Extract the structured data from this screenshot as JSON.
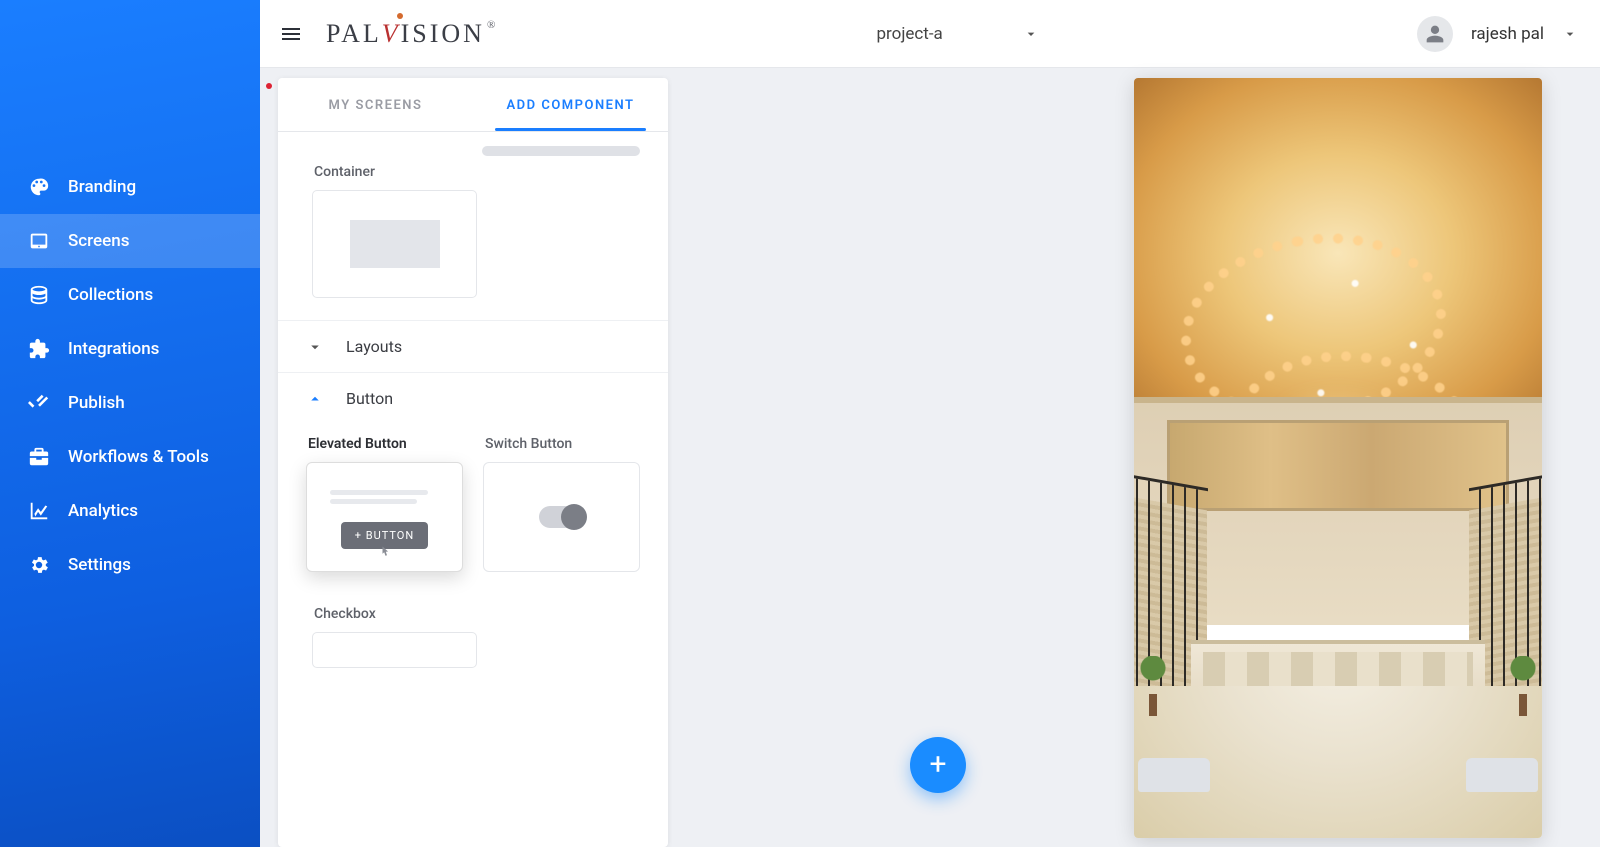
{
  "brand": {
    "name_left": "PAL",
    "name_v": "V",
    "name_right": "ISION",
    "registered": "®"
  },
  "topbar": {
    "project": "project-a",
    "username": "rajesh pal"
  },
  "sidebar": {
    "items": [
      {
        "key": "branding",
        "label": "Branding"
      },
      {
        "key": "screens",
        "label": "Screens"
      },
      {
        "key": "collections",
        "label": "Collections"
      },
      {
        "key": "integrations",
        "label": "Integrations"
      },
      {
        "key": "publish",
        "label": "Publish"
      },
      {
        "key": "workflows",
        "label": "Workflows & Tools"
      },
      {
        "key": "analytics",
        "label": "Analytics"
      },
      {
        "key": "settings",
        "label": "Settings"
      }
    ],
    "active": "screens"
  },
  "panel": {
    "tabs": {
      "my_screens": "MY SCREENS",
      "add_component": "ADD COMPONENT"
    },
    "active_tab": "add_component",
    "container_label": "Container",
    "accordion": {
      "layouts": "Layouts",
      "button": "Button"
    },
    "components": {
      "elevated_button": {
        "label": "Elevated Button",
        "demo_text": "+ BUTTON"
      },
      "switch_button": {
        "label": "Switch Button"
      },
      "checkbox": {
        "label": "Checkbox"
      }
    }
  },
  "fab": {
    "glyph": "+"
  }
}
